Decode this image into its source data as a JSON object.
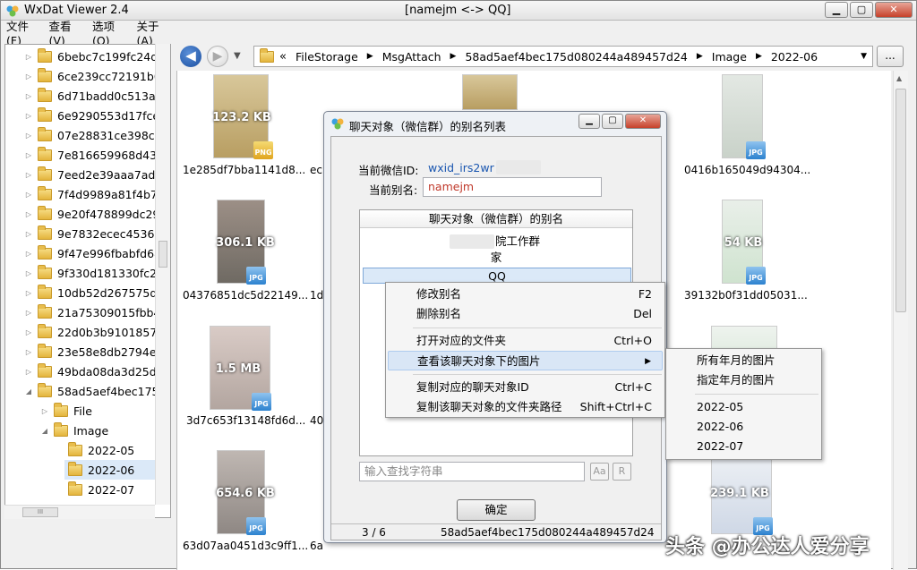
{
  "app": {
    "title": "WxDat Viewer 2.4",
    "document_title": "[namejm <-> QQ]",
    "window_buttons": [
      "▁",
      "▢",
      "✕"
    ]
  },
  "menu": [
    "文件(F)",
    "查看(V)",
    "选项(O)",
    "关于(A)"
  ],
  "tree": {
    "items": [
      {
        "label": "6bebc7c199fc24d9",
        "arrow": "▷"
      },
      {
        "label": "6ce239cc72191b05",
        "arrow": "▷"
      },
      {
        "label": "6d71badd0c513a5",
        "arrow": "▷"
      },
      {
        "label": "6e9290553d17fcee",
        "arrow": "▷"
      },
      {
        "label": "07e28831ce398ccf",
        "arrow": "▷"
      },
      {
        "label": "7e816659968d43c",
        "arrow": "▷"
      },
      {
        "label": "7eed2e39aaa7ad4",
        "arrow": "▷"
      },
      {
        "label": "7f4d9989a81f4b7e",
        "arrow": "▷"
      },
      {
        "label": "9e20f478899dc29e",
        "arrow": "▷"
      },
      {
        "label": "9e7832ecec453624",
        "arrow": "▷"
      },
      {
        "label": "9f47e996fbabfd68",
        "arrow": "▷"
      },
      {
        "label": "9f330d181330fc20",
        "arrow": "▷"
      },
      {
        "label": "10db52d267575d8",
        "arrow": "▷"
      },
      {
        "label": "21a75309015fbb4",
        "arrow": "▷"
      },
      {
        "label": "22d0b3b9101857f8",
        "arrow": "▷"
      },
      {
        "label": "23e58e8db2794eb",
        "arrow": "▷"
      },
      {
        "label": "49bda08da3d25d4",
        "arrow": "▷"
      },
      {
        "label": "58ad5aef4bec175c",
        "arrow": "◢"
      },
      {
        "label": "File",
        "arrow": "▷"
      },
      {
        "label": "Image",
        "arrow": "◢"
      },
      {
        "label": "2022-05",
        "arrow": ""
      },
      {
        "label": "2022-06",
        "arrow": ""
      },
      {
        "label": "2022-07",
        "arrow": ""
      }
    ],
    "hscroll_grip": "III"
  },
  "nav": {
    "back": "◀",
    "forward": "▶",
    "dropdown": "▼",
    "breadcrumb": [
      "«",
      "FileStorage",
      "MsgAttach",
      "58ad5aef4bec175d080244a489457d24",
      "Image",
      "2022-06"
    ],
    "more": "..."
  },
  "files": [
    {
      "name": "1e285df7bba1141d8...",
      "size": "123.2 KB",
      "badge": "PNG"
    },
    {
      "name": "04376851dc5d22149...",
      "size": "306.1 KB",
      "badge": "JPG"
    },
    {
      "name": "3d7c653f13148fd6d...",
      "size": "1.5 MB",
      "badge": "JPG"
    },
    {
      "name": "63d07aa0451d3c9ff1...",
      "size": "654.6 KB",
      "badge": "JPG"
    },
    {
      "name": "ec",
      "size": "",
      "badge": ""
    },
    {
      "name": "1d",
      "size": "",
      "badge": ""
    },
    {
      "name": "40",
      "size": "",
      "badge": ""
    },
    {
      "name": "6a",
      "size": "",
      "badge": ""
    },
    {
      "name": "0416b165049d94304...",
      "size": "",
      "badge": "JPG"
    },
    {
      "name": "39132b0f31dd05031...",
      "size": "54 KB",
      "badge": "JPG"
    },
    {
      "name": "",
      "size": "239.1 KB",
      "badge": "JPG"
    }
  ],
  "dialog": {
    "title": "聊天对象（微信群）的别名列表",
    "current_wechat_label": "当前微信ID:",
    "current_wechat_value": "wxid_irs2wr",
    "current_alias_label": "当前别名:",
    "current_alias_value": "namejm",
    "list_header": "聊天对象（微信群）的别名",
    "list_items": [
      "院工作群",
      "家",
      "QQ"
    ],
    "search_placeholder": "输入查找字符串",
    "btn_case": "Aa",
    "btn_regex": "R",
    "ok": "确定",
    "status_count": "3 / 6",
    "status_id": "58ad5aef4bec175d080244a489457d24"
  },
  "context_menu": [
    {
      "label": "修改别名",
      "shortcut": "F2"
    },
    {
      "label": "删除别名",
      "shortcut": "Del"
    },
    {
      "label": "打开对应的文件夹",
      "shortcut": "Ctrl+O"
    },
    {
      "label": "查看该聊天对象下的图片",
      "shortcut": "▶"
    },
    {
      "label": "复制对应的聊天对象ID",
      "shortcut": "Ctrl+C"
    },
    {
      "label": "复制该聊天对象的文件夹路径",
      "shortcut": "Shift+Ctrl+C"
    }
  ],
  "submenu": [
    "所有年月的图片",
    "指定年月的图片",
    "2022-05",
    "2022-06",
    "2022-07"
  ],
  "watermark": "头条 @办公达人爱分享",
  "colors": {
    "accent": "#1a56b0",
    "alias_text": "#c0392b",
    "selection": "#dbe9f8"
  }
}
